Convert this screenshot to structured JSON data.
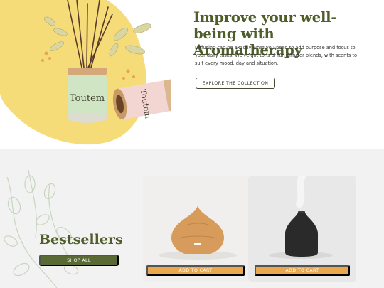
{
  "hero": {
    "title": "Improve your well-being with Aromatherapy",
    "description": "Diffusing can be exactly what you need to add purpose and focus to your daily tasks. We've got tons of fun diffuser blends, with scents to suit every mood, day and situation.",
    "cta_label": "EXPLORE THE COLLECTION",
    "jar_brand_text": "Toutem"
  },
  "bestsellers": {
    "title": "Bestsellers",
    "shop_all_label": "SHOP ALL",
    "products": [
      {
        "image": "wood-grain-diffuser",
        "button_label": "ADD TO CART"
      },
      {
        "image": "black-ceramic-diffuser",
        "button_label": "ADD TO CART"
      }
    ]
  },
  "colors": {
    "accent_green": "#4f5d2a",
    "button_green": "#5a6a35",
    "yellow_blob": "#f5dc78",
    "cart_orange": "#e9a84b",
    "section_bg": "#f2f2f2"
  }
}
